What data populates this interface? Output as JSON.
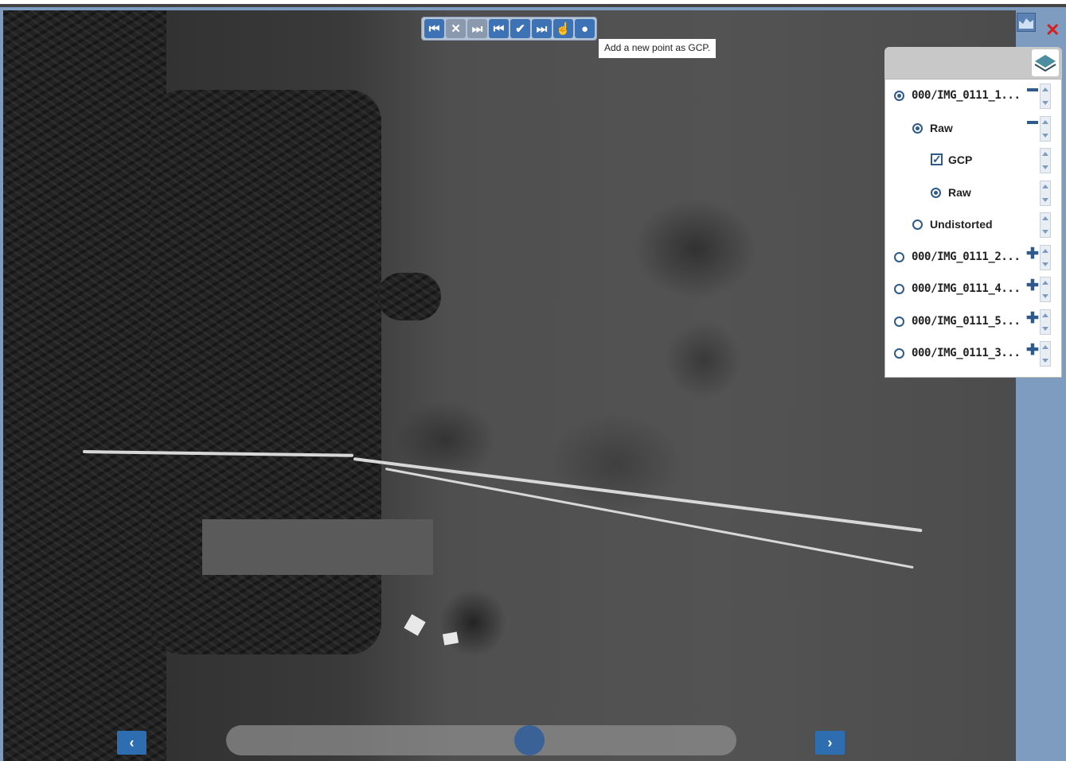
{
  "toolbar": {
    "buttons": [
      {
        "name": "first-image-button",
        "glyph": "⏮"
      },
      {
        "name": "reject-image-button",
        "glyph": "✕"
      },
      {
        "name": "next-unchecked-button",
        "glyph": "⏭"
      },
      {
        "name": "previous-point-button",
        "glyph": "⏮"
      },
      {
        "name": "accept-point-button",
        "glyph": "✔"
      },
      {
        "name": "next-point-button",
        "glyph": "⏭"
      },
      {
        "name": "pan-tool-button",
        "glyph": "☝"
      },
      {
        "name": "add-gcp-button",
        "glyph": "●"
      }
    ],
    "tooltip": "Add a new point as GCP."
  },
  "layers": {
    "items": [
      {
        "label": "000/IMG_0111_1...",
        "type": "radio",
        "checked": true,
        "toggle": "minus",
        "indent": 0
      },
      {
        "label": "Raw",
        "type": "radio",
        "checked": true,
        "toggle": "minus",
        "indent": 1
      },
      {
        "label": "GCP",
        "type": "checkbox",
        "checked": true,
        "toggle": "",
        "indent": 2
      },
      {
        "label": "Raw",
        "type": "radio",
        "checked": true,
        "toggle": "",
        "indent": 2
      },
      {
        "label": "Undistorted",
        "type": "radio",
        "checked": false,
        "toggle": "",
        "indent": 1
      },
      {
        "label": "000/IMG_0111_2...",
        "type": "radio",
        "checked": false,
        "toggle": "plus",
        "indent": 0
      },
      {
        "label": "000/IMG_0111_4...",
        "type": "radio",
        "checked": false,
        "toggle": "plus",
        "indent": 0
      },
      {
        "label": "000/IMG_0111_5...",
        "type": "radio",
        "checked": false,
        "toggle": "plus",
        "indent": 0
      },
      {
        "label": "000/IMG_0111_3...",
        "type": "radio",
        "checked": false,
        "toggle": "plus",
        "indent": 0
      }
    ]
  },
  "navigation": {
    "prev_glyph": "‹",
    "next_glyph": "›"
  },
  "slider": {
    "position_fraction": 0.6
  },
  "colors": {
    "accent": "#2f6db1",
    "panel_bg": "#7e9cc0",
    "close": "#d62020"
  }
}
